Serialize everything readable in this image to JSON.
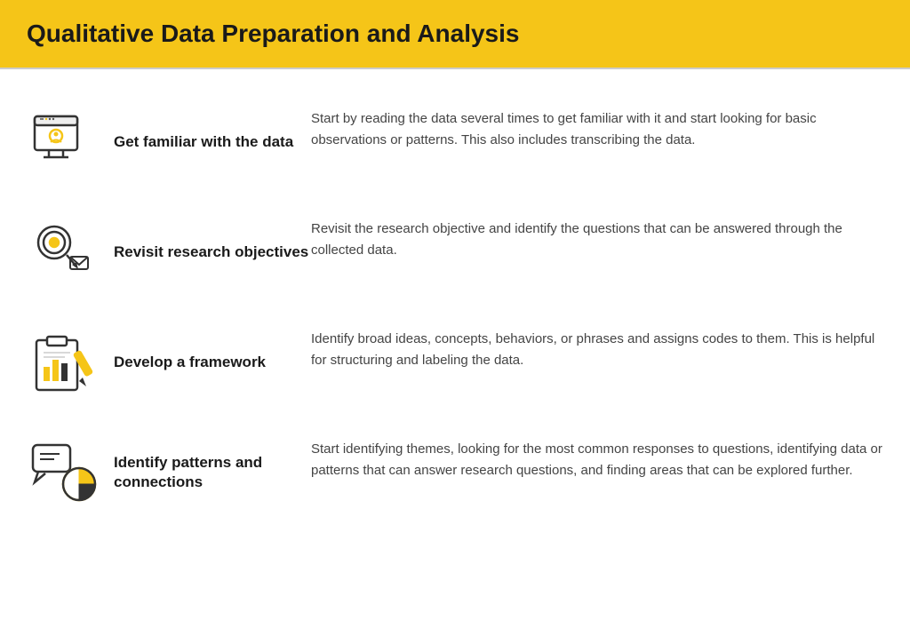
{
  "header": {
    "title": "Qualitative Data Preparation and Analysis"
  },
  "items": [
    {
      "id": "familiar",
      "label": "Get familiar with the data",
      "description": "Start by reading the data several times to get familiar with it and start looking for basic observations or patterns. This also includes transcribing the data.",
      "icon": "data-icon"
    },
    {
      "id": "revisit",
      "label": "Revisit research objectives",
      "description": "Revisit the research objective and identify the questions that can be answered through the collected data.",
      "icon": "objectives-icon"
    },
    {
      "id": "framework",
      "label": "Develop a framework",
      "description": "Identify broad ideas, concepts, behaviors, or phrases and assigns codes to them. This is helpful for structuring and labeling the data.",
      "icon": "framework-icon"
    },
    {
      "id": "patterns",
      "label": "Identify patterns and connections",
      "description": "Start identifying themes, looking for the most common responses to questions, identifying data or patterns that can answer research questions, and finding areas that can be explored further.",
      "icon": "patterns-icon"
    }
  ]
}
